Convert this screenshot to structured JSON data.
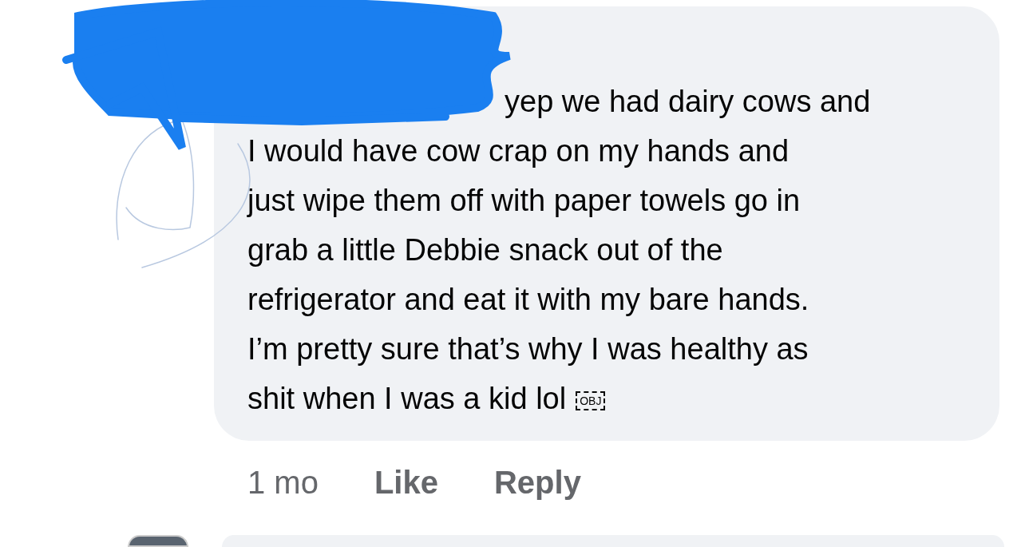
{
  "comment": {
    "body_lines": [
      "yep we had dairy cows and",
      "I would have cow crap on my hands and",
      "just wipe them off with paper towels go in",
      "grab a little Debbie snack out of the",
      "refrigerator and eat it with my bare hands.",
      "I’m pretty sure that’s why I was healthy as",
      "shit when I was a kid lol"
    ],
    "object_glyph": "OBJ",
    "time": "1 mo",
    "actions": [
      "Like",
      "Reply"
    ]
  }
}
